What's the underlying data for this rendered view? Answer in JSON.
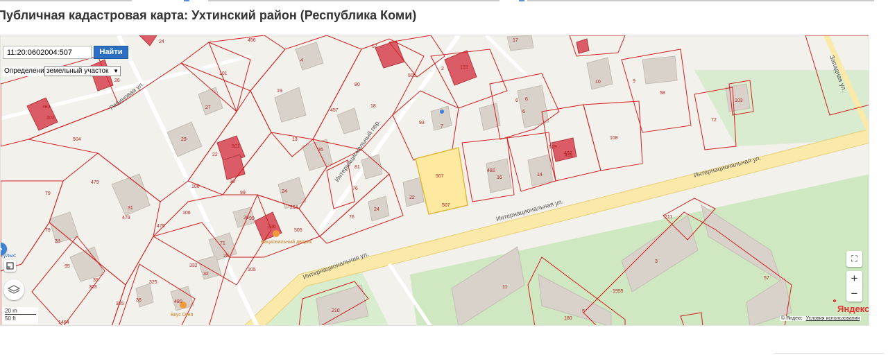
{
  "page": {
    "title": "Публичная кадастровая карта: Ухтинский район (Республика Коми)"
  },
  "search": {
    "cadastral_value": "11:20:0602004:507",
    "find_label": "Найти",
    "definition_label": "Определение:",
    "definition_selected": "земельный участок"
  },
  "colors": {
    "parcel_border": "#d21f1f",
    "selected_fill": "#fdeaa0",
    "selected_border": "#e2b93a",
    "building_red": "#db5c66",
    "building_3d": "#d8d2ca",
    "road_main": "#fbe9a9",
    "green": "#cfe8c2",
    "background": "#f1eee8"
  },
  "map": {
    "streets": [
      "Интернациональная ул.",
      "Интернациональная ул.",
      "Интернациональная ул.",
      "Интернациональный пер.",
      "Рябиновая ул.",
      "Западная ул."
    ],
    "labels": [
      "456",
      "24",
      "101",
      "4",
      "57",
      "80",
      "505",
      "17",
      "26",
      "19",
      "457",
      "18",
      "483",
      "302",
      "27",
      "504",
      "29",
      "22",
      "501",
      "13",
      "26",
      "81",
      "93",
      "7",
      "2",
      "103",
      "10",
      "58",
      "103",
      "72",
      "6",
      "509",
      "492",
      "108",
      "482",
      "16",
      "14",
      "479",
      "106",
      "30",
      "99",
      "24",
      "76",
      "24",
      "507",
      "507",
      "22",
      "79",
      "31",
      "479",
      "106",
      "26A",
      "76",
      "479",
      "505",
      "211",
      "79",
      "33",
      "71",
      "26",
      "99",
      "336",
      "95",
      "35",
      "303",
      "28",
      "332",
      "32",
      "105",
      "325",
      "36",
      "480",
      "325",
      "1464",
      "210",
      "11",
      "3",
      "1955",
      "180",
      "5",
      "57",
      "6",
      "6",
      "9",
      "452"
    ],
    "pois": [
      "Национальный дворик",
      "Вкус Огня"
    ],
    "controls": {
      "fullscreen_icon": "fullscreen-icon",
      "zoom_in": "+",
      "zoom_out": "−",
      "layers_icon": "layers-icon",
      "ruler_icon": "ruler-icon"
    },
    "scale": {
      "meters": "20 m",
      "feet": "50 ft"
    },
    "attribution": {
      "logo": "Яндекс",
      "copyright": "© Яндекс",
      "terms": "Условия использования"
    },
    "route_label": "тулыс"
  }
}
